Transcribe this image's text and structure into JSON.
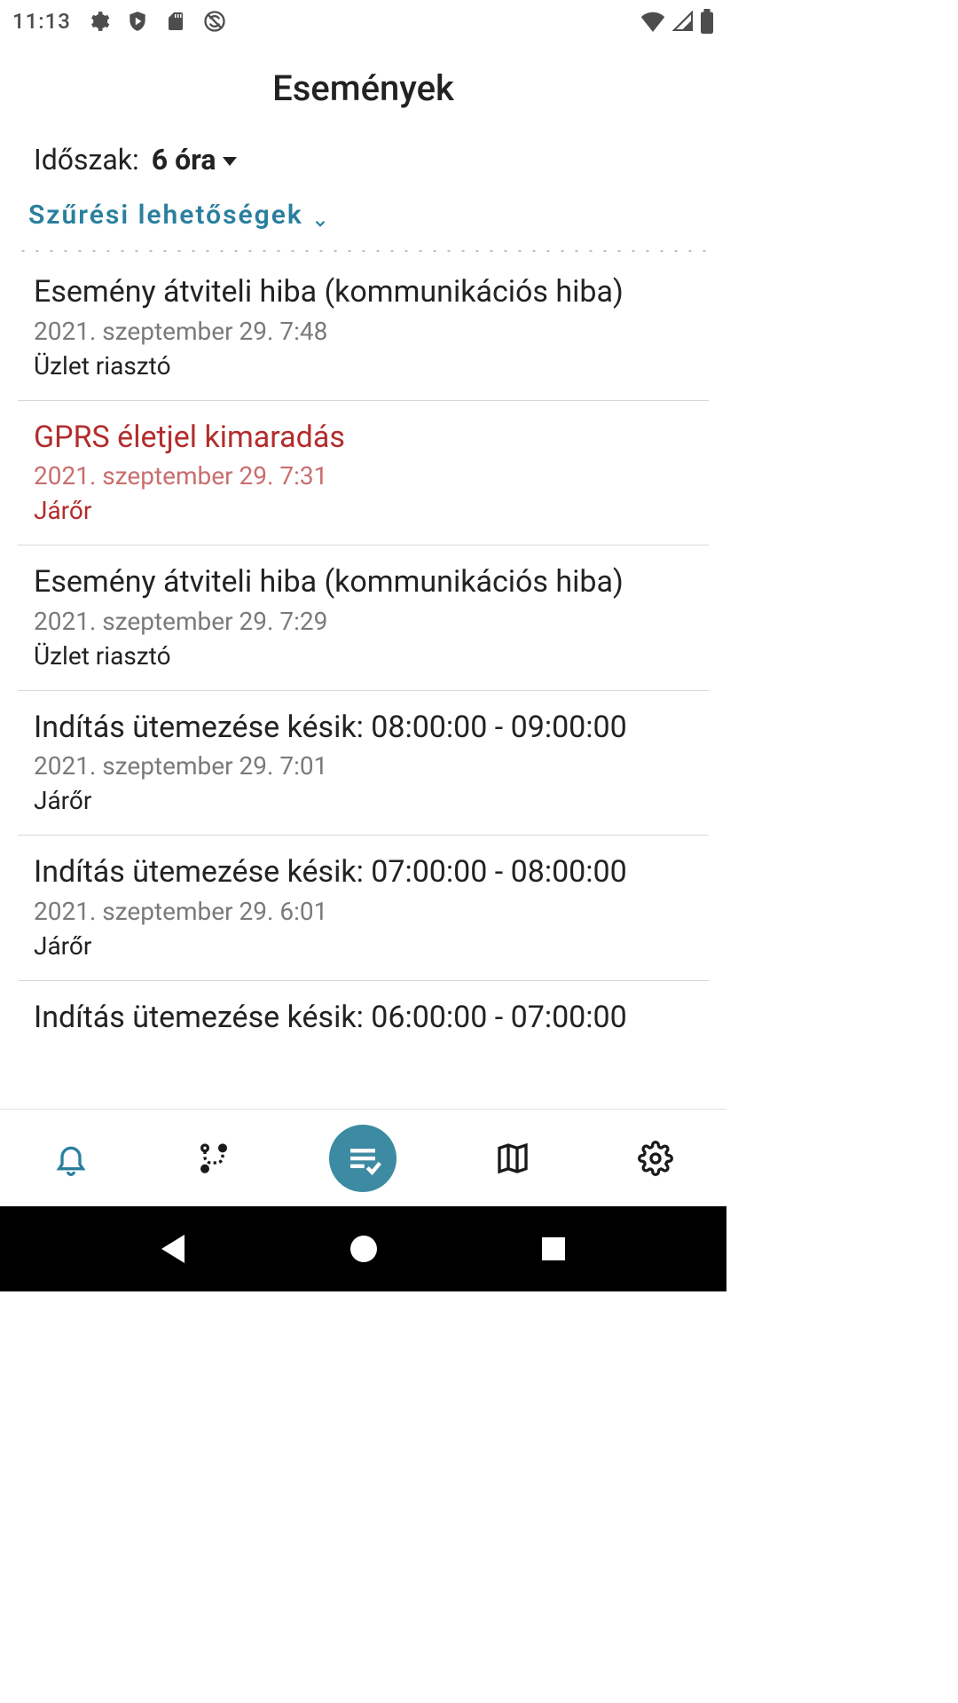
{
  "status": {
    "time": "11:13",
    "icons_left": [
      "gear",
      "shield-play",
      "sd-card",
      "no-sync"
    ],
    "icons_right": [
      "wifi",
      "cell-signal",
      "battery"
    ]
  },
  "header": {
    "title": "Események"
  },
  "period": {
    "label": "Időszak:",
    "value": "6 óra"
  },
  "filter": {
    "label": "Szűrési lehetőségek"
  },
  "events": [
    {
      "title": "Esemény átviteli hiba (kommunikációs hiba)",
      "date": "2021. szeptember 29. 7:48",
      "source": "Üzlet riasztó",
      "alert": false
    },
    {
      "title": "GPRS életjel kimaradás",
      "date": "2021. szeptember 29. 7:31",
      "source": "Járőr",
      "alert": true
    },
    {
      "title": "Esemény átviteli hiba (kommunikációs hiba)",
      "date": "2021. szeptember 29. 7:29",
      "source": "Üzlet riasztó",
      "alert": false
    },
    {
      "title": "Indítás ütemezése késik: 08:00:00 - 09:00:00",
      "date": "2021. szeptember 29. 7:01",
      "source": "Járőr",
      "alert": false
    },
    {
      "title": "Indítás ütemezése késik: 07:00:00 - 08:00:00",
      "date": "2021. szeptember 29. 6:01",
      "source": "Járőr",
      "alert": false
    },
    {
      "title": "Indítás ütemezése késik: 06:00:00 - 07:00:00",
      "date": "",
      "source": "",
      "alert": false
    }
  ],
  "nav": {
    "items": [
      "bell",
      "route",
      "checklist",
      "map",
      "gear"
    ],
    "active": 2
  },
  "colors": {
    "accent": "#3d8aa3",
    "link": "#2a7f9e",
    "alert": "#b32d2d"
  }
}
